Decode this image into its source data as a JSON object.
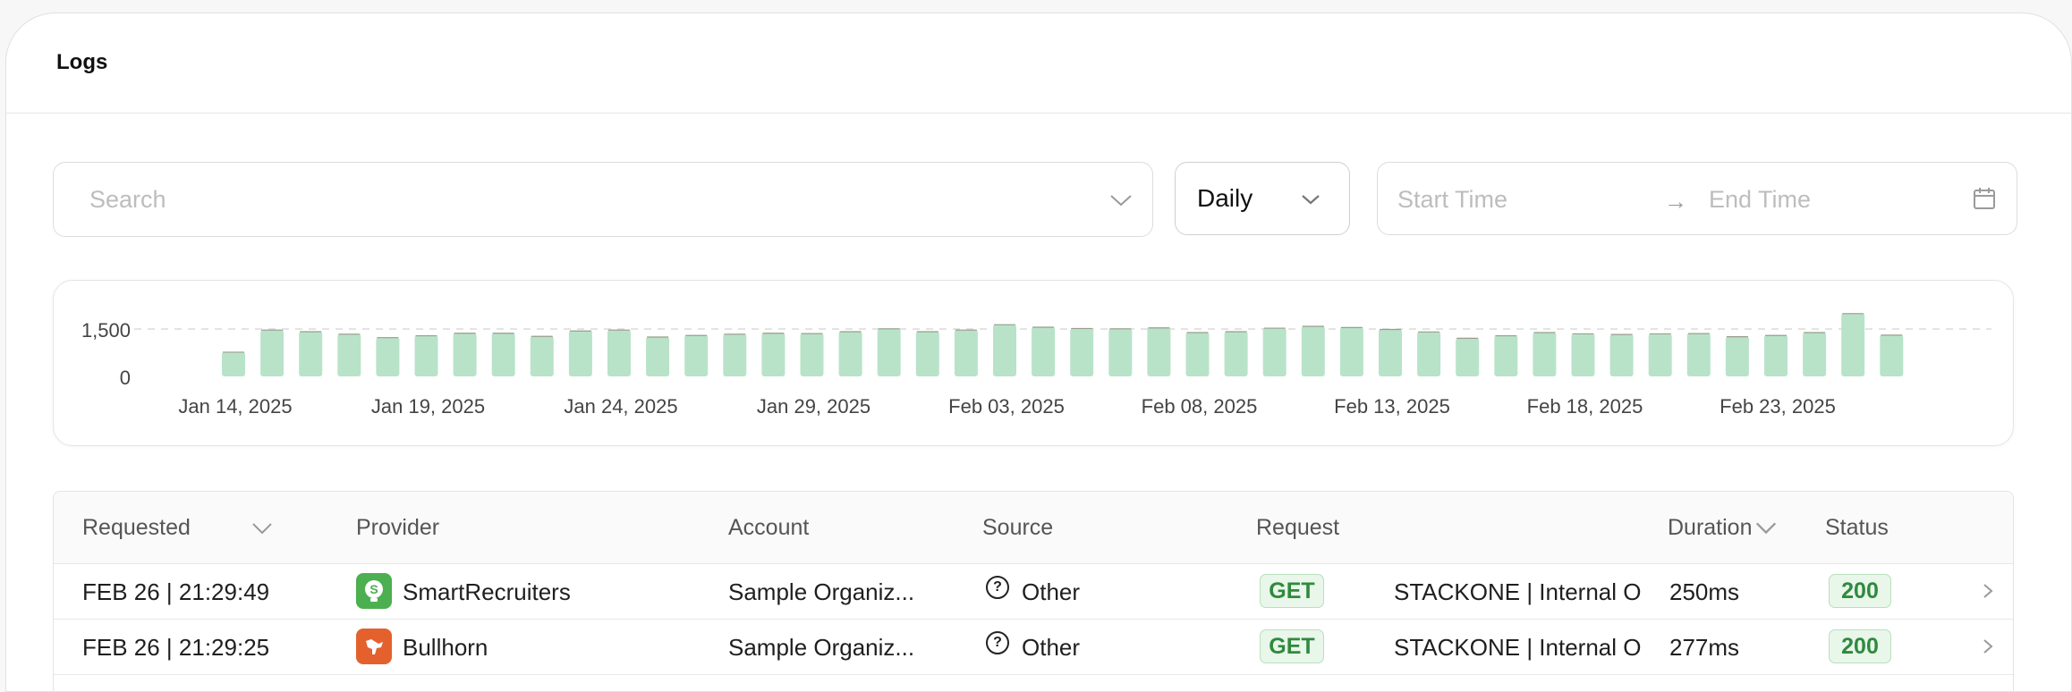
{
  "page": {
    "title": "Logs"
  },
  "filters": {
    "search_placeholder": "Search",
    "interval": "Daily",
    "start_placeholder": "Start Time",
    "end_placeholder": "End Time",
    "arrow": "→"
  },
  "chart_data": {
    "type": "bar",
    "y_ticks": [
      "1,500",
      "0"
    ],
    "ylim": [
      0,
      1600
    ],
    "reference_line": 1500,
    "x_tick_labels": [
      "Jan 14, 2025",
      "Jan 19, 2025",
      "Jan 24, 2025",
      "Jan 29, 2025",
      "Feb 03, 2025",
      "Feb 08, 2025",
      "Feb 13, 2025",
      "Feb 18, 2025",
      "Feb 23, 2025"
    ],
    "categories": [
      "Jan 14",
      "Jan 15",
      "Jan 16",
      "Jan 17",
      "Jan 18",
      "Jan 19",
      "Jan 20",
      "Jan 21",
      "Jan 22",
      "Jan 23",
      "Jan 24",
      "Jan 25",
      "Jan 26",
      "Jan 27",
      "Jan 28",
      "Jan 29",
      "Jan 30",
      "Jan 31",
      "Feb 01",
      "Feb 02",
      "Feb 03",
      "Feb 04",
      "Feb 05",
      "Feb 06",
      "Feb 07",
      "Feb 08",
      "Feb 09",
      "Feb 10",
      "Feb 11",
      "Feb 12",
      "Feb 13",
      "Feb 14",
      "Feb 15",
      "Feb 16",
      "Feb 17",
      "Feb 18",
      "Feb 19",
      "Feb 20",
      "Feb 21",
      "Feb 22",
      "Feb 23",
      "Feb 24",
      "Feb 25",
      "Feb 26"
    ],
    "values": [
      780,
      1480,
      1430,
      1350,
      1240,
      1300,
      1380,
      1380,
      1280,
      1450,
      1480,
      1260,
      1310,
      1350,
      1380,
      1370,
      1430,
      1520,
      1430,
      1480,
      1650,
      1570,
      1530,
      1520,
      1550,
      1400,
      1430,
      1540,
      1600,
      1560,
      1500,
      1420,
      1220,
      1300,
      1400,
      1360,
      1340,
      1360,
      1370,
      1270,
      1310,
      1400,
      2000,
      1320
    ],
    "grid": false
  },
  "table": {
    "columns": [
      "Requested",
      "Provider",
      "Account",
      "Source",
      "Request",
      "Duration",
      "Status"
    ],
    "rows": [
      {
        "requested": "FEB 26 | 21:29:49",
        "provider": "SmartRecruiters",
        "account": "Sample Organiz...",
        "source": "Other",
        "method": "GET",
        "request": "STACKONE | Internal O",
        "duration": "250ms",
        "status": "200"
      },
      {
        "requested": "FEB 26 | 21:29:25",
        "provider": "Bullhorn",
        "account": "Sample Organiz...",
        "source": "Other",
        "method": "GET",
        "request": "STACKONE | Internal O",
        "duration": "277ms",
        "status": "200"
      }
    ]
  },
  "colors": {
    "bar": "#b8e3c9",
    "bar_top": "#9c9c8a",
    "status_green": "#2f8a3d",
    "smartrecruiters": "#4caf50",
    "bullhorn": "#e4612e"
  },
  "icons": {
    "smartrecruiters_letter": "S",
    "help": "?"
  }
}
